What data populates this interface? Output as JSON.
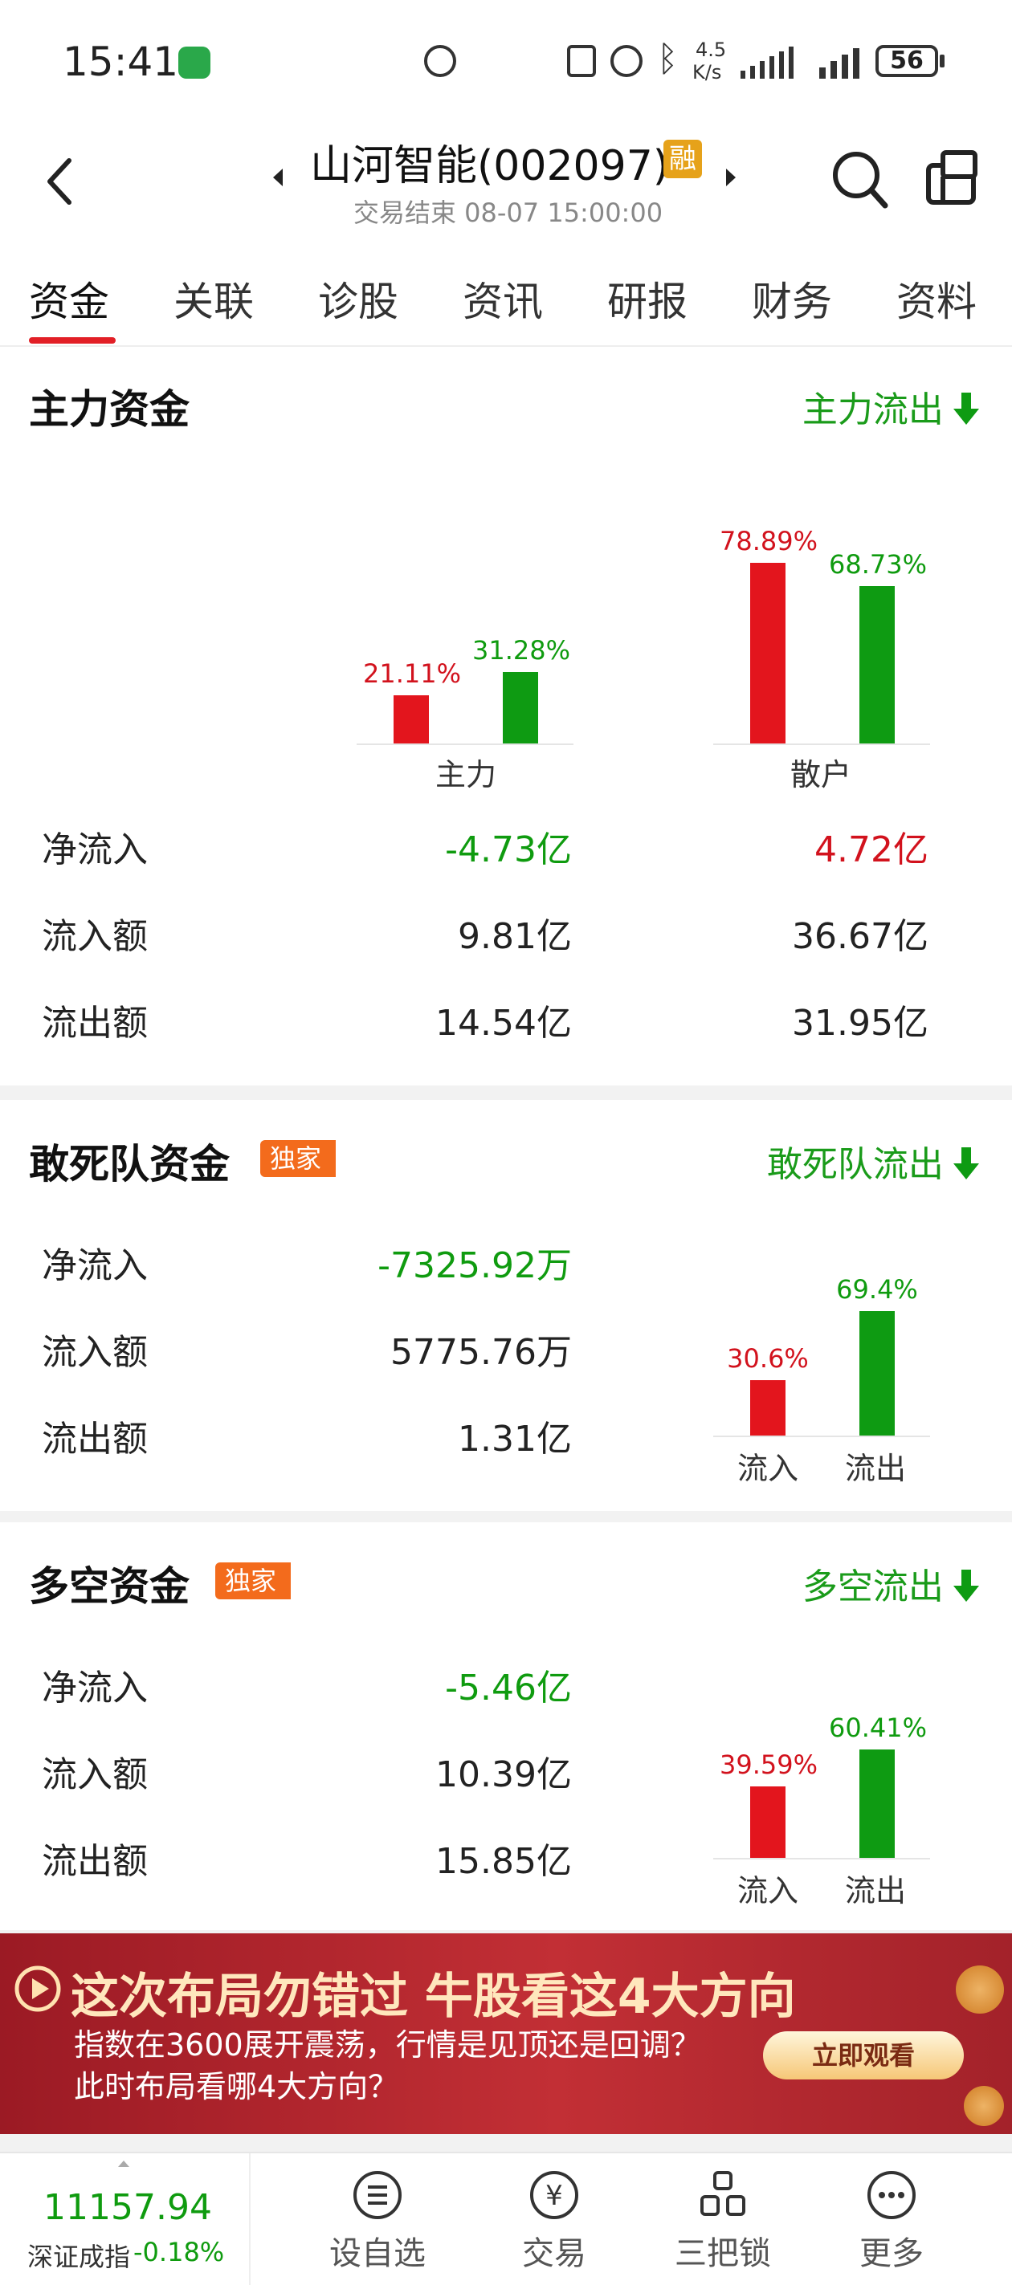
{
  "status_bar": {
    "time": "15:41",
    "net_speed_top": "4.5",
    "net_speed_bottom": "K/s",
    "battery": "56"
  },
  "header": {
    "title": "山河智能(002097)",
    "margin_badge": "融",
    "subtitle": "交易结束 08-07 15:00:00"
  },
  "tabs": [
    "资金",
    "关联",
    "诊股",
    "资讯",
    "研报",
    "财务",
    "资料"
  ],
  "main_fund": {
    "title": "主力资金",
    "flow": "主力流出",
    "groups": [
      {
        "name": "主力",
        "in_pct": 21.11,
        "in_label": "21.11%",
        "out_pct": 31.28,
        "out_label": "31.28%"
      },
      {
        "name": "散户",
        "in_pct": 78.89,
        "in_label": "78.89%",
        "out_pct": 68.73,
        "out_label": "68.73%"
      }
    ],
    "rows": [
      {
        "label": "净流入",
        "main": "-4.73亿",
        "retail": "4.72亿"
      },
      {
        "label": "流入额",
        "main": "9.81亿",
        "retail": "36.67亿"
      },
      {
        "label": "流出额",
        "main": "14.54亿",
        "retail": "31.95亿"
      }
    ]
  },
  "dare_fund": {
    "title": "敢死队资金",
    "badge": "独家",
    "flow": "敢死队流出",
    "rows": [
      {
        "label": "净流入",
        "value": "-7325.92万"
      },
      {
        "label": "流入额",
        "value": "5775.76万"
      },
      {
        "label": "流出额",
        "value": "1.31亿"
      }
    ],
    "in_pct": 30.6,
    "in_label": "30.6%",
    "out_pct": 69.4,
    "out_label": "69.4%",
    "in_axis": "流入",
    "out_axis": "流出"
  },
  "ls_fund": {
    "title": "多空资金",
    "badge": "独家",
    "flow": "多空流出",
    "rows": [
      {
        "label": "净流入",
        "value": "-5.46亿"
      },
      {
        "label": "流入额",
        "value": "10.39亿"
      },
      {
        "label": "流出额",
        "value": "15.85亿"
      }
    ],
    "in_pct": 39.59,
    "in_label": "39.59%",
    "out_pct": 60.41,
    "out_label": "60.41%",
    "in_axis": "流入",
    "out_axis": "流出"
  },
  "banner": {
    "headline": "这次布局勿错过 牛股看这4大方向",
    "line1": "指数在3600展开震荡，行情是见顶还是回调？",
    "line2": "此时布局看哪4大方向？",
    "cta": "立即观看"
  },
  "bottom_bar": {
    "index_value": "11157.94",
    "index_name": "深证成指",
    "index_change": "-0.18%",
    "items": [
      "设自选",
      "交易",
      "三把锁",
      "更多"
    ]
  },
  "colors": {
    "up_red": "#e3151d",
    "down_green": "#0e9b12",
    "accent": "#e21f26",
    "badge": "#f36b1c"
  }
}
